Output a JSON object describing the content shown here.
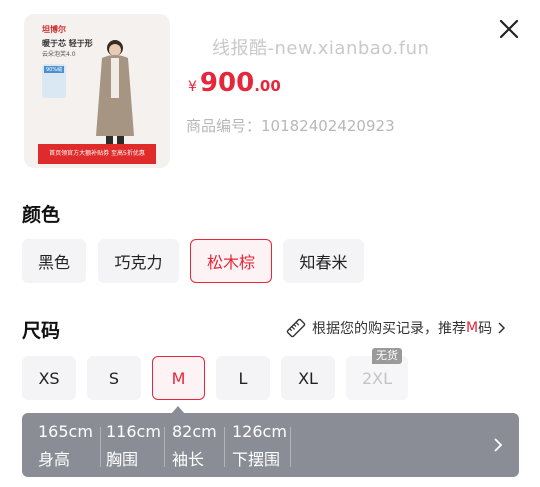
{
  "watermark": "线报酷-new.xianbao.fun",
  "product": {
    "image": {
      "brand": "坦博尔",
      "line1": "暖于芯 轻于形",
      "line2": "云朵泡芙4.0",
      "badge": "90%绒",
      "banner": "首页领官方大额补贴券 至高5折优惠"
    },
    "price_symbol": "¥",
    "price_integer": "900",
    "price_decimal": ".00",
    "sku": "商品编号：10182402420923"
  },
  "color_section": {
    "title": "颜色",
    "options": [
      "黑色",
      "巧克力",
      "松木棕",
      "知春米"
    ],
    "selected": "松木棕"
  },
  "size_section": {
    "title": "尺码",
    "recommend_prefix": "根据您的购买记录，推荐",
    "recommend_size": "M",
    "recommend_suffix": "码",
    "options": [
      "XS",
      "S",
      "M",
      "L",
      "XL",
      "2XL"
    ],
    "selected": "M",
    "out_of_stock": "2XL",
    "out_of_stock_label": "无货"
  },
  "size_detail": {
    "items": [
      {
        "value": "165cm",
        "label": "身高"
      },
      {
        "value": "116cm",
        "label": "胸围"
      },
      {
        "value": "82cm",
        "label": "袖长"
      },
      {
        "value": "126cm",
        "label": "下摆围"
      }
    ]
  },
  "colors": {
    "accent": "#e6263a",
    "chip_bg": "#f4f4f6",
    "panel_bg": "#8a8d96"
  },
  "icons": [
    "close-icon",
    "ruler-icon",
    "chevron-right-icon"
  ]
}
